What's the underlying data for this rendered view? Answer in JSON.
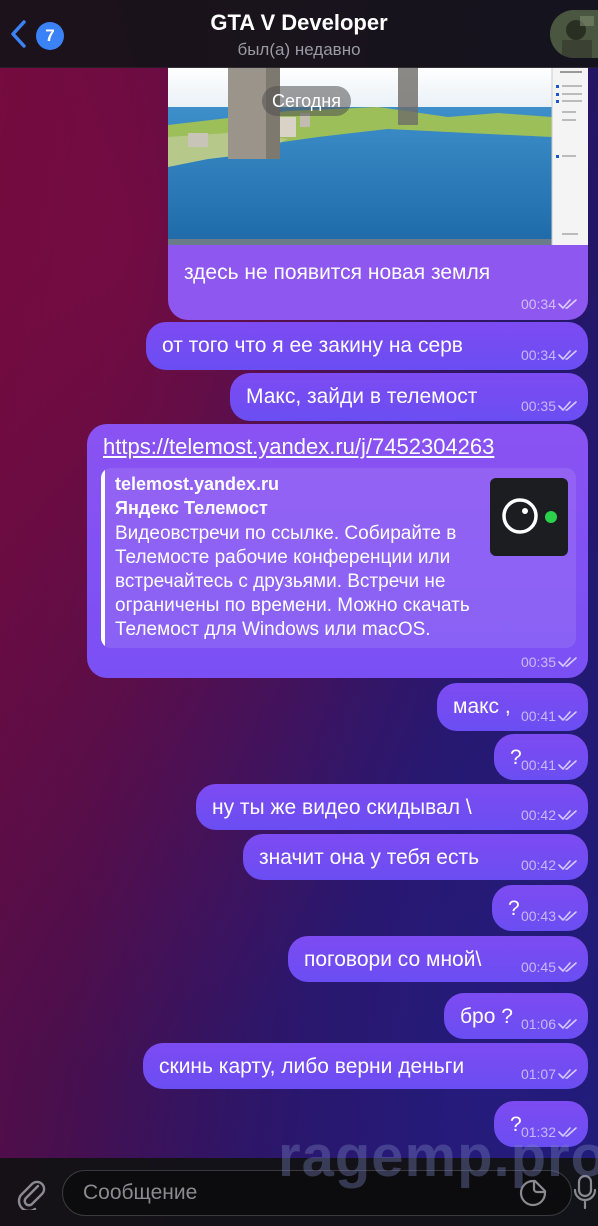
{
  "header": {
    "title": "GTA V Developer",
    "status": "был(а) недавно",
    "unread_count": "7"
  },
  "image_message": {
    "date_chip": "Сегодня",
    "caption": "здесь не появится новая земля",
    "time": "00:34"
  },
  "messages": [
    {
      "text": "от того что я ее закину на серв",
      "time": "00:34"
    },
    {
      "text": "Макс, зайди в телемост",
      "time": "00:35"
    },
    {
      "text": "макс ,",
      "time": "00:41"
    },
    {
      "text": "?",
      "time": "00:41"
    },
    {
      "text": "ну ты же видео скидывал \\",
      "time": "00:42"
    },
    {
      "text": "значит она у тебя есть",
      "time": "00:42"
    },
    {
      "text": "?",
      "time": "00:43"
    },
    {
      "text": "поговори со мной\\",
      "time": "00:45"
    },
    {
      "text": "бро ?",
      "time": "01:06"
    },
    {
      "text": "скинь карту, либо верни деньги",
      "time": "01:07"
    },
    {
      "text": "?",
      "time": "01:32"
    }
  ],
  "link_message": {
    "url": "https://telemost.yandex.ru/j/7452304263",
    "site": "telemost.yandex.ru",
    "title": "Яндекс Телемост",
    "description": "Видеовстречи по ссылке. Собирайте в Телемосте рабочие конференции или встречайтесь с друзьями. Встречи не ограничены по времени. Можно скачать Телемост для Windows или macOS.",
    "time": "00:35"
  },
  "input": {
    "placeholder": "Сообщение"
  },
  "watermark": "ragemp.pro",
  "colors": {
    "bubble": "#7b4cf2",
    "header_bg": "#141418",
    "accent": "#3b82f6"
  }
}
